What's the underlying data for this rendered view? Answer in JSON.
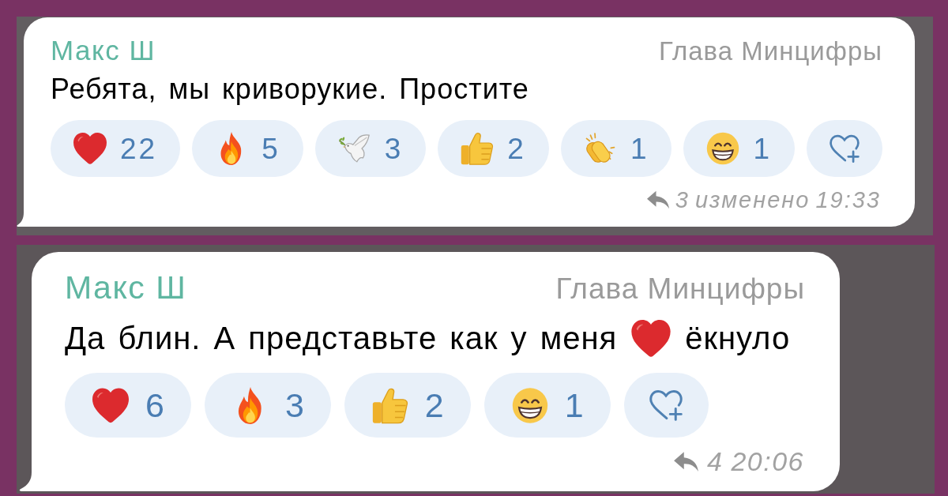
{
  "messages": [
    {
      "sender": "Макс Ш",
      "sender_title": "Глава Минцифры",
      "text_parts": [
        {
          "kind": "text",
          "text": "Ребята, мы криворукие. Простите"
        }
      ],
      "reactions": [
        {
          "kind": "heart",
          "count": "22"
        },
        {
          "kind": "fire",
          "count": "5"
        },
        {
          "kind": "dove",
          "count": "3"
        },
        {
          "kind": "thumbs_up",
          "count": "2"
        },
        {
          "kind": "clap",
          "count": "1"
        },
        {
          "kind": "grin",
          "count": "1"
        },
        {
          "kind": "add"
        }
      ],
      "replies": "3",
      "edited_label": "изменено",
      "time": "19:33"
    },
    {
      "sender": "Макс Ш",
      "sender_title": "Глава Минцифры",
      "text_parts": [
        {
          "kind": "text",
          "text": "Да блин. А представьте как у меня"
        },
        {
          "kind": "heart"
        },
        {
          "kind": "text",
          "text": "ёкнуло"
        }
      ],
      "reactions": [
        {
          "kind": "heart",
          "count": "6"
        },
        {
          "kind": "fire",
          "count": "3"
        },
        {
          "kind": "thumbs_up",
          "count": "2"
        },
        {
          "kind": "grin",
          "count": "1"
        },
        {
          "kind": "add"
        }
      ],
      "replies": "4",
      "time": "20:06"
    }
  ]
}
